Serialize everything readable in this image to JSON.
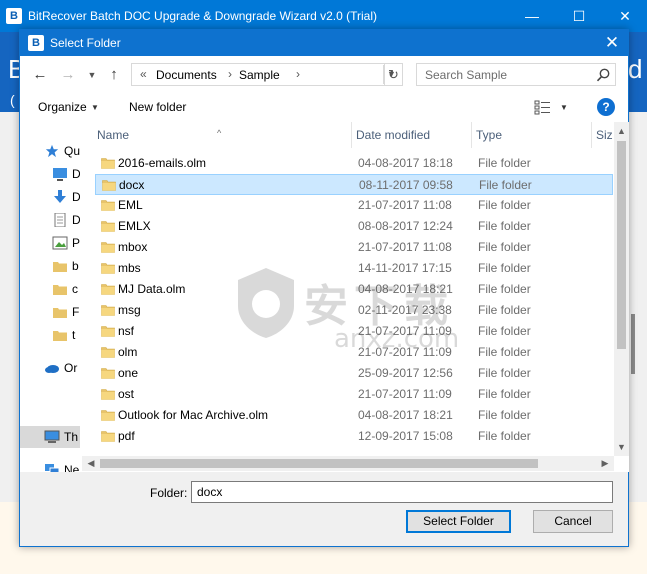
{
  "app": {
    "title": "BitRecover Batch DOC Upgrade & Downgrade Wizard v2.0 (Trial)",
    "logo_letter": "B",
    "banner_left": "B",
    "banner_left_sub": "(",
    "banner_right": "d",
    "window_controls": {
      "minimize": "—",
      "maximize": "☐",
      "close": "✕"
    }
  },
  "dialog": {
    "title": "Select Folder",
    "logo_letter": "B",
    "close": "✕",
    "address": {
      "prefix": "«",
      "crumbs": [
        "Documents",
        "Sample"
      ],
      "separator": "›"
    },
    "search": {
      "placeholder": "Search Sample"
    },
    "toolbar": {
      "organize": "Organize",
      "new_folder": "New folder",
      "help": "?"
    },
    "nav": [
      {
        "label": "Qu",
        "icon": "star-icon"
      },
      {
        "label": "D",
        "icon": "desktop-icon"
      },
      {
        "label": "D",
        "icon": "downloads-icon"
      },
      {
        "label": "D",
        "icon": "documents-icon"
      },
      {
        "label": "P",
        "icon": "pictures-icon"
      },
      {
        "label": "b",
        "icon": "folder-icon"
      },
      {
        "label": "c",
        "icon": "folder-icon"
      },
      {
        "label": "F",
        "icon": "folder-icon"
      },
      {
        "label": "t",
        "icon": "folder-icon"
      },
      {
        "label": "Or",
        "icon": "onedrive-icon"
      },
      {
        "label": "Th",
        "icon": "this-pc-icon"
      },
      {
        "label": "Ne",
        "icon": "network-icon"
      }
    ],
    "columns": {
      "name": "Name",
      "date": "Date modified",
      "type": "Type",
      "size": "Siz"
    },
    "files": [
      {
        "name": "2016-emails.olm",
        "date": "04-08-2017 18:18",
        "type": "File folder"
      },
      {
        "name": "docx",
        "date": "08-11-2017 09:58",
        "type": "File folder"
      },
      {
        "name": "EML",
        "date": "21-07-2017 11:08",
        "type": "File folder"
      },
      {
        "name": "EMLX",
        "date": "08-08-2017 12:24",
        "type": "File folder"
      },
      {
        "name": "mbox",
        "date": "21-07-2017 11:08",
        "type": "File folder"
      },
      {
        "name": "mbs",
        "date": "14-11-2017 17:15",
        "type": "File folder"
      },
      {
        "name": "MJ Data.olm",
        "date": "04-08-2017 18:21",
        "type": "File folder"
      },
      {
        "name": "msg",
        "date": "02-11-2017 23:38",
        "type": "File folder"
      },
      {
        "name": "nsf",
        "date": "21-07-2017 11:09",
        "type": "File folder"
      },
      {
        "name": "olm",
        "date": "21-07-2017 11:09",
        "type": "File folder"
      },
      {
        "name": "one",
        "date": "25-09-2017 12:56",
        "type": "File folder"
      },
      {
        "name": "ost",
        "date": "21-07-2017 11:09",
        "type": "File folder"
      },
      {
        "name": "Outlook for Mac Archive.olm",
        "date": "04-08-2017 18:21",
        "type": "File folder"
      },
      {
        "name": "pdf",
        "date": "12-09-2017 15:08",
        "type": "File folder"
      }
    ],
    "selected_file": "docx",
    "folder_label": "Folder:",
    "folder_value": "docx",
    "buttons": {
      "select": "Select Folder",
      "cancel": "Cancel"
    },
    "watermark": {
      "text": "安下载",
      "sub": "anxz.com"
    }
  },
  "colors": {
    "titlebar": "#0078d7",
    "selection": "#cce8ff",
    "folder": "#e8c46a",
    "help": "#0e6fd1"
  }
}
